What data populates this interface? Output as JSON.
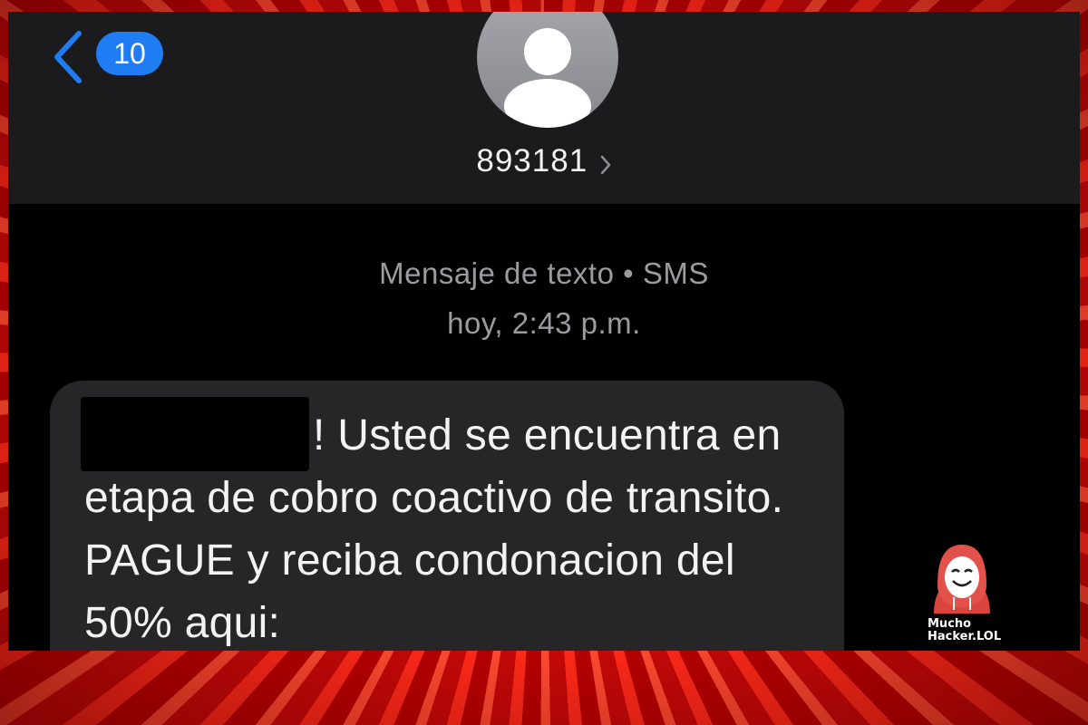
{
  "header": {
    "back_badge_count": "10",
    "contact_name": "893181"
  },
  "thread": {
    "message_type": "Mensaje de texto • SMS",
    "timestamp": "hoy, 2:43 p.m."
  },
  "message": {
    "text": "! Usted se encuentra en etapa de cobro coactivo de transito. PAGUE y reciba condonacion del 50% aqui:",
    "redacted": true
  },
  "watermark": {
    "line1": "Mucho",
    "line2": "Hacker.LOL",
    "icon": "hacker-mascot-icon"
  },
  "colors": {
    "accent": "#1f7cf2",
    "frame": "#d60f0f",
    "bubble": "#262628"
  }
}
